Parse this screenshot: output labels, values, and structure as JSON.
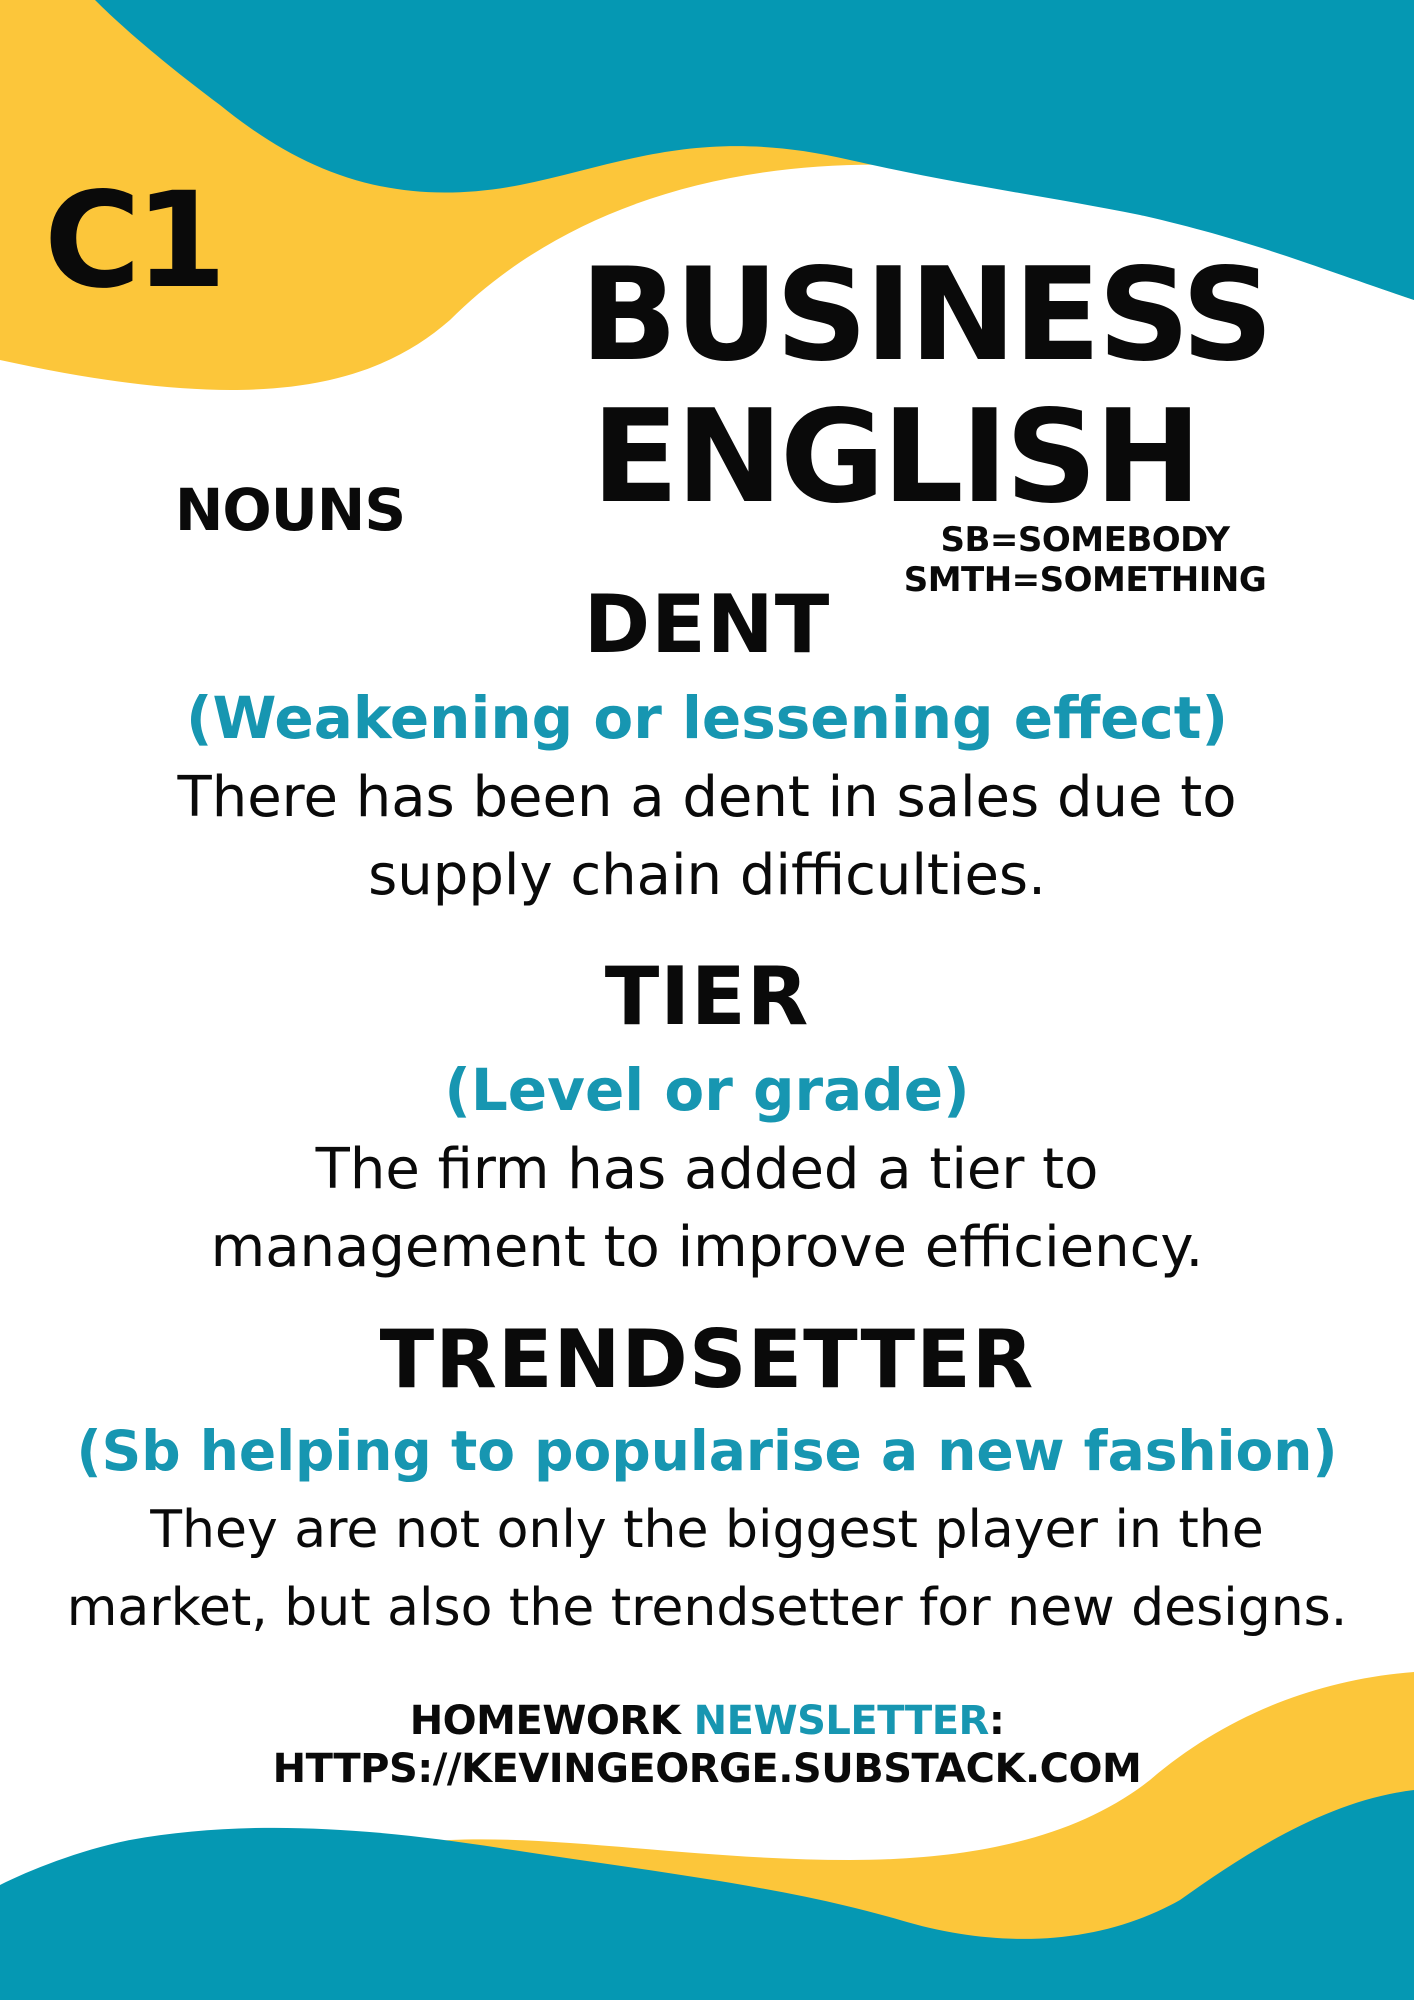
{
  "header": {
    "level": "C1",
    "title_line1": "BUSINESS",
    "title_line2": "ENGLISH",
    "category": "NOUNS",
    "legend": "SB=SOMEBODY SMTH=SOMETHING"
  },
  "entries": [
    {
      "word": "DENT",
      "definition": "(Weakening or lessening effect)",
      "example_line1": "There has been a dent in sales due to",
      "example_line2": "supply chain difficulties."
    },
    {
      "word": "TIER",
      "definition": "(Level or grade)",
      "example_line1": "The firm has added a tier to",
      "example_line2": "management to improve efficiency."
    },
    {
      "word": "TRENDSETTER",
      "definition": "(Sb helping to popularise a new fashion)",
      "example_line1": "They are not only the biggest player in the",
      "example_line2": "market, but also the trendsetter for new designs."
    }
  ],
  "footer": {
    "homework": "HOMEWORK",
    "newsletter": "NEWSLETTER",
    "colon": ":",
    "url": "HTTPS://KEVINGEORGE.SUBSTACK.COM"
  },
  "colors": {
    "yellow": "#fcc63a",
    "teal": "#0598b3",
    "accent_text": "#1796b1",
    "text": "#0a0a0a"
  }
}
